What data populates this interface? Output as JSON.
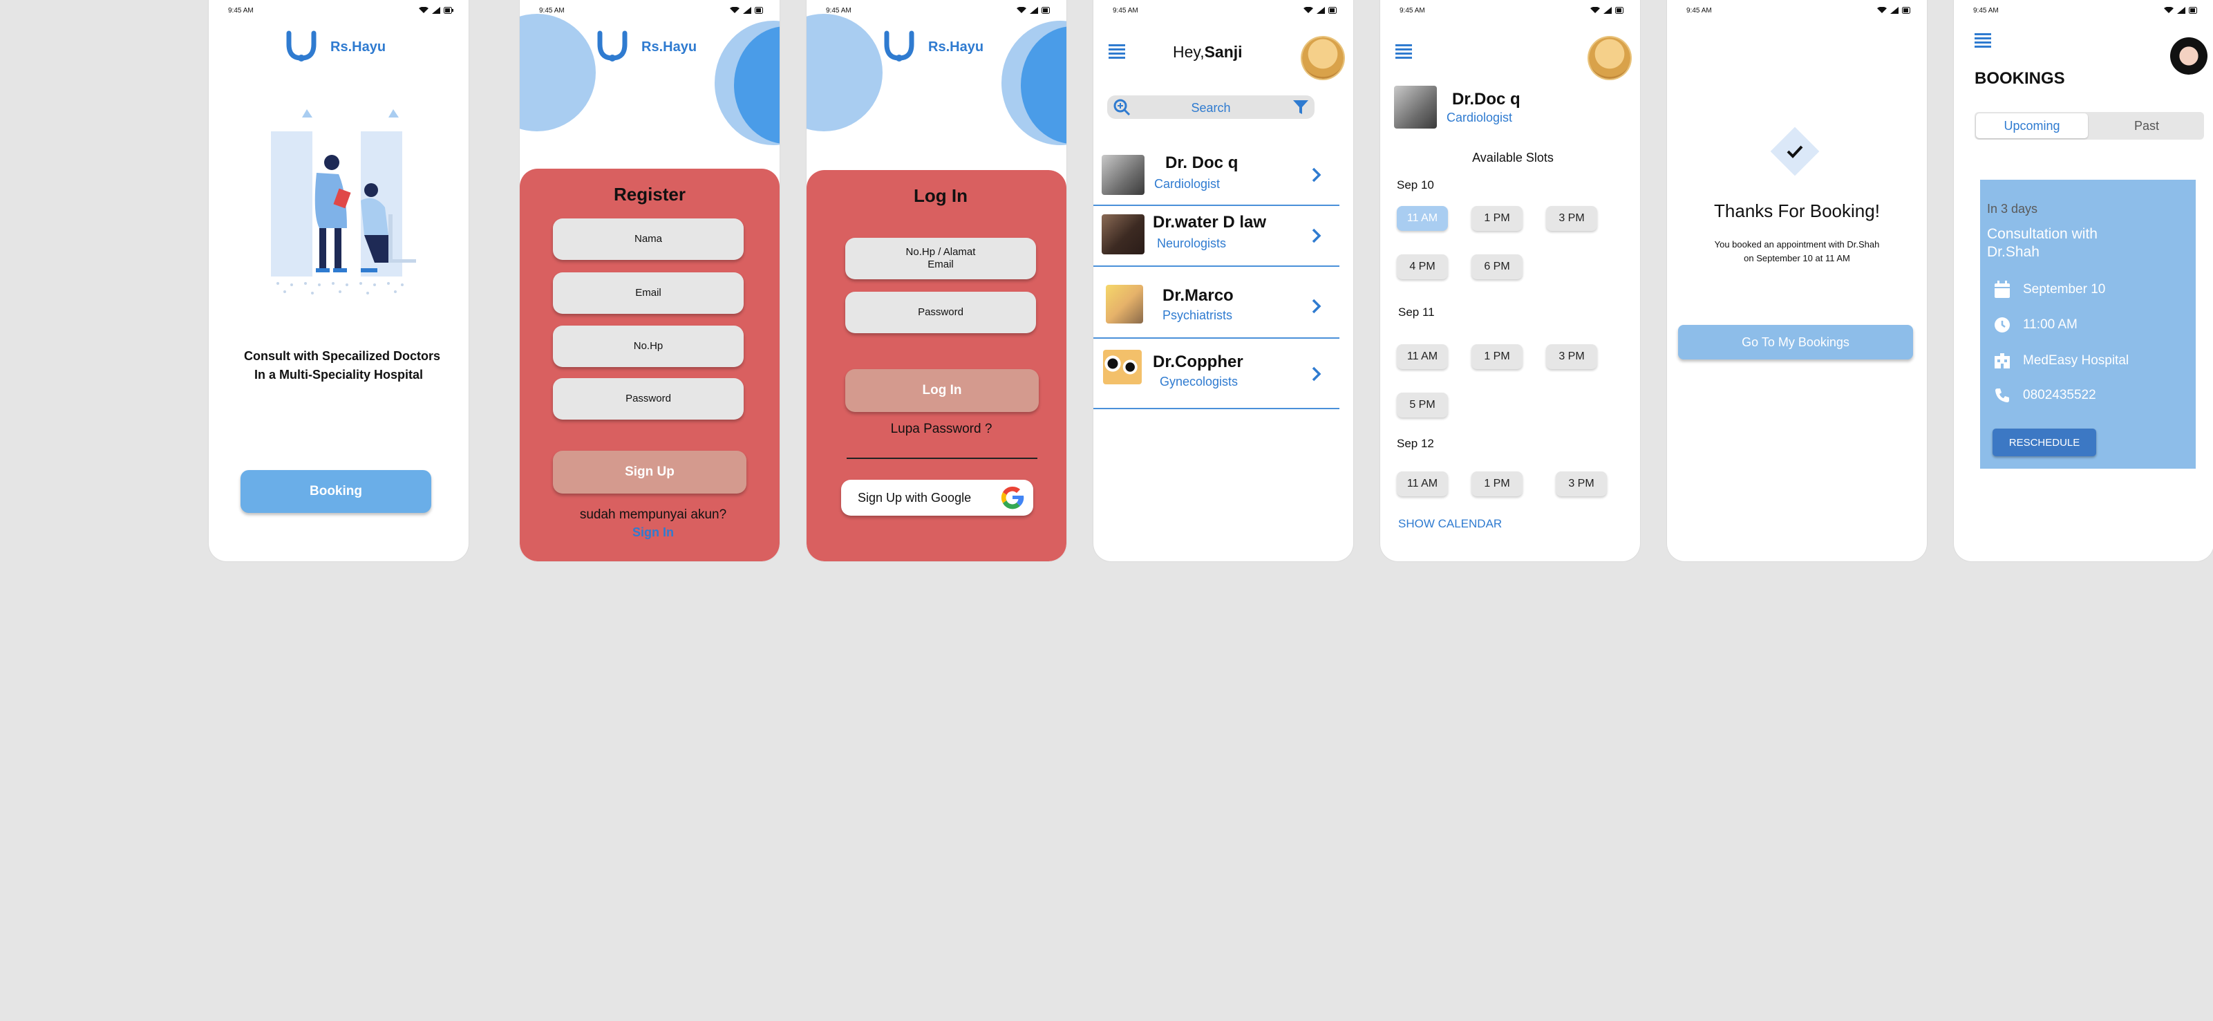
{
  "status_time": "9:45 AM",
  "brand": "Rs.Hayu",
  "colors": {
    "accent": "#2f7bd0",
    "coral": "#d96060",
    "light_blue": "#a9cdf1",
    "button_blue": "#6aaee8",
    "card_blue": "#8dbde9"
  },
  "welcome": {
    "headline_line1": "Consult with Specailized Doctors",
    "headline_line2": "In a Multi-Speciality Hospital",
    "booking_button": "Booking"
  },
  "register": {
    "title": "Register",
    "fields": [
      "Nama",
      "Email",
      "No.Hp",
      "Password"
    ],
    "signup_button": "Sign Up",
    "have_account": "sudah mempunyai akun?",
    "signin_link": "Sign In"
  },
  "login": {
    "title": "Log In",
    "phone_email_line1": "No.Hp / Alamat",
    "phone_email_line2": "Email",
    "password_field": "Password",
    "login_button": "Log In",
    "forgot": "Lupa Password ?",
    "google_button": "Sign Up with Google"
  },
  "home": {
    "greeting_prefix": "Hey,",
    "greeting_name": "Sanji",
    "search_placeholder": "Search",
    "doctors": [
      {
        "name": "Dr. Doc q",
        "specialty": "Cardiologist"
      },
      {
        "name": "Dr.water D law",
        "specialty": "Neurologists"
      },
      {
        "name": "Dr.Marco",
        "specialty": "Psychiatrists"
      },
      {
        "name": "Dr.Coppher",
        "specialty": "Gynecologists"
      }
    ]
  },
  "slots": {
    "doctor_name": "Dr.Doc q",
    "doctor_specialty": "Cardiologist",
    "heading": "Available Slots",
    "days": [
      {
        "date": "Sep 10",
        "times": [
          "11 AM",
          "1 PM",
          "3 PM",
          "4 PM",
          "6 PM"
        ],
        "selected": "11 AM"
      },
      {
        "date": "Sep 11",
        "times": [
          "11 AM",
          "1 PM",
          "3 PM",
          "5 PM"
        ]
      },
      {
        "date": "Sep 12",
        "times": [
          "11 AM",
          "1 PM",
          "3 PM"
        ]
      }
    ],
    "show_calendar": "SHOW CALENDAR"
  },
  "thanks": {
    "title": "Thanks For Booking!",
    "message_line1": "You booked an appointment with Dr.Shah",
    "message_line2": "on September 10 at 11 AM",
    "button": "Go To My Bookings"
  },
  "bookings": {
    "title": "BOOKINGS",
    "tabs": [
      "Upcoming",
      "Past"
    ],
    "active_tab": "Upcoming",
    "card": {
      "eta": "In 3 days",
      "consult_line1": "Consultation with",
      "consult_line2": "Dr.Shah",
      "date": "September 10",
      "time": "11:00 AM",
      "hospital": "MedEasy Hospital",
      "phone": "0802435522",
      "reschedule": "RESCHEDULE"
    }
  }
}
